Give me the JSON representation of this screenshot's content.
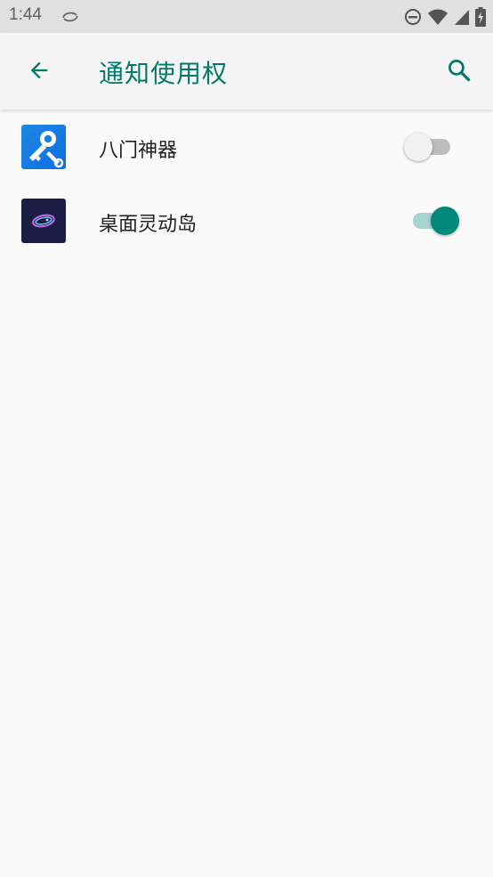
{
  "status_bar": {
    "time": "1:44"
  },
  "app_bar": {
    "title": "通知使用权"
  },
  "apps": [
    {
      "name": "八门神器",
      "enabled": false,
      "icon": "key-wrench-icon"
    },
    {
      "name": "桌面灵动岛",
      "enabled": true,
      "icon": "island-icon"
    }
  ],
  "colors": {
    "accent": "#00796b",
    "switch_on": "#00897b",
    "switch_track_on": "#a6d4cf",
    "switch_off": "#f1f1f1"
  }
}
